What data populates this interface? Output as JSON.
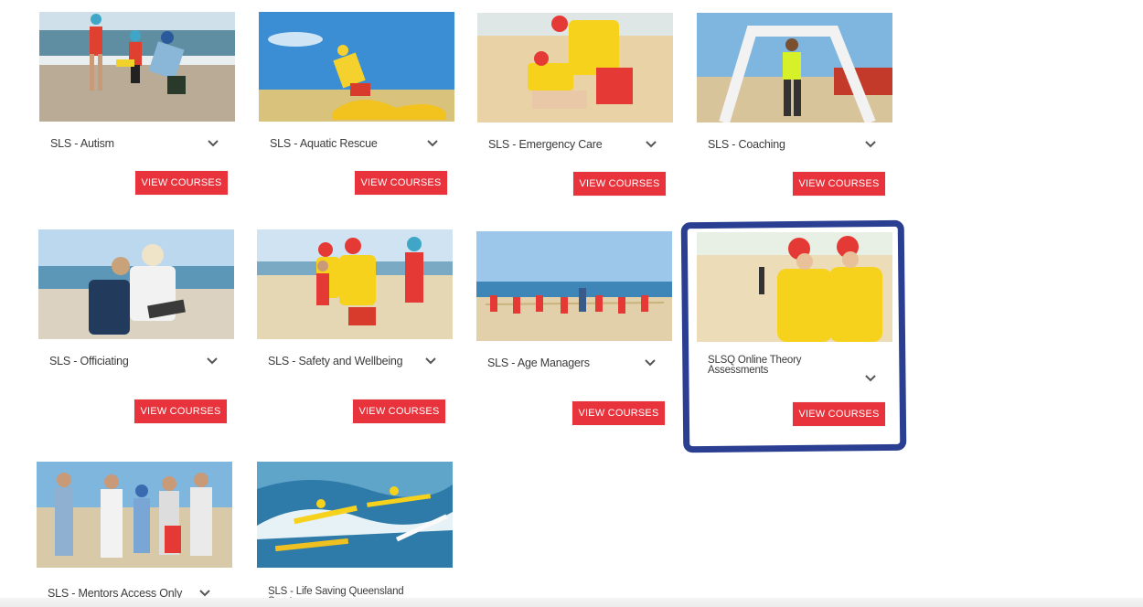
{
  "cards": [
    {
      "title": "SLS - Autism",
      "button": "VIEW COURSES",
      "image": "beach-kids-instructor",
      "selected": false
    },
    {
      "title": "SLS - Aquatic Rescue",
      "button": "VIEW COURSES",
      "image": "rescue-tube",
      "selected": false
    },
    {
      "title": "SLS - Emergency Care",
      "button": "VIEW COURSES",
      "image": "cpr-beach",
      "selected": false
    },
    {
      "title": "SLS - Coaching",
      "button": "VIEW COURSES",
      "image": "finish-line",
      "selected": false
    },
    {
      "title": "SLS - Officiating",
      "button": "VIEW COURSES",
      "image": "officials-clipboard",
      "selected": false
    },
    {
      "title": "SLS - Safety and Wellbeing",
      "button": "VIEW COURSES",
      "image": "lifesavers-group",
      "selected": false
    },
    {
      "title": "SLS - Age Managers",
      "button": "VIEW COURSES",
      "image": "tug-of-war",
      "selected": false
    },
    {
      "title": "SLSQ Online Theory Assessments",
      "button": "VIEW COURSES",
      "image": "patrol-radio",
      "selected": true
    },
    {
      "title": "SLS - Mentors Access Only",
      "button": "",
      "image": "mentors-group",
      "selected": false
    },
    {
      "title": "SLS - Life Saving Queensland Sports",
      "button": "",
      "image": "surf-boards",
      "selected": false
    }
  ],
  "icons": {
    "expand": "chevron-down-icon"
  },
  "colors": {
    "button": "#e8323c",
    "highlight": "#2a3f91",
    "patrol_yellow": "#f7d21c",
    "patrol_red": "#e53935"
  }
}
